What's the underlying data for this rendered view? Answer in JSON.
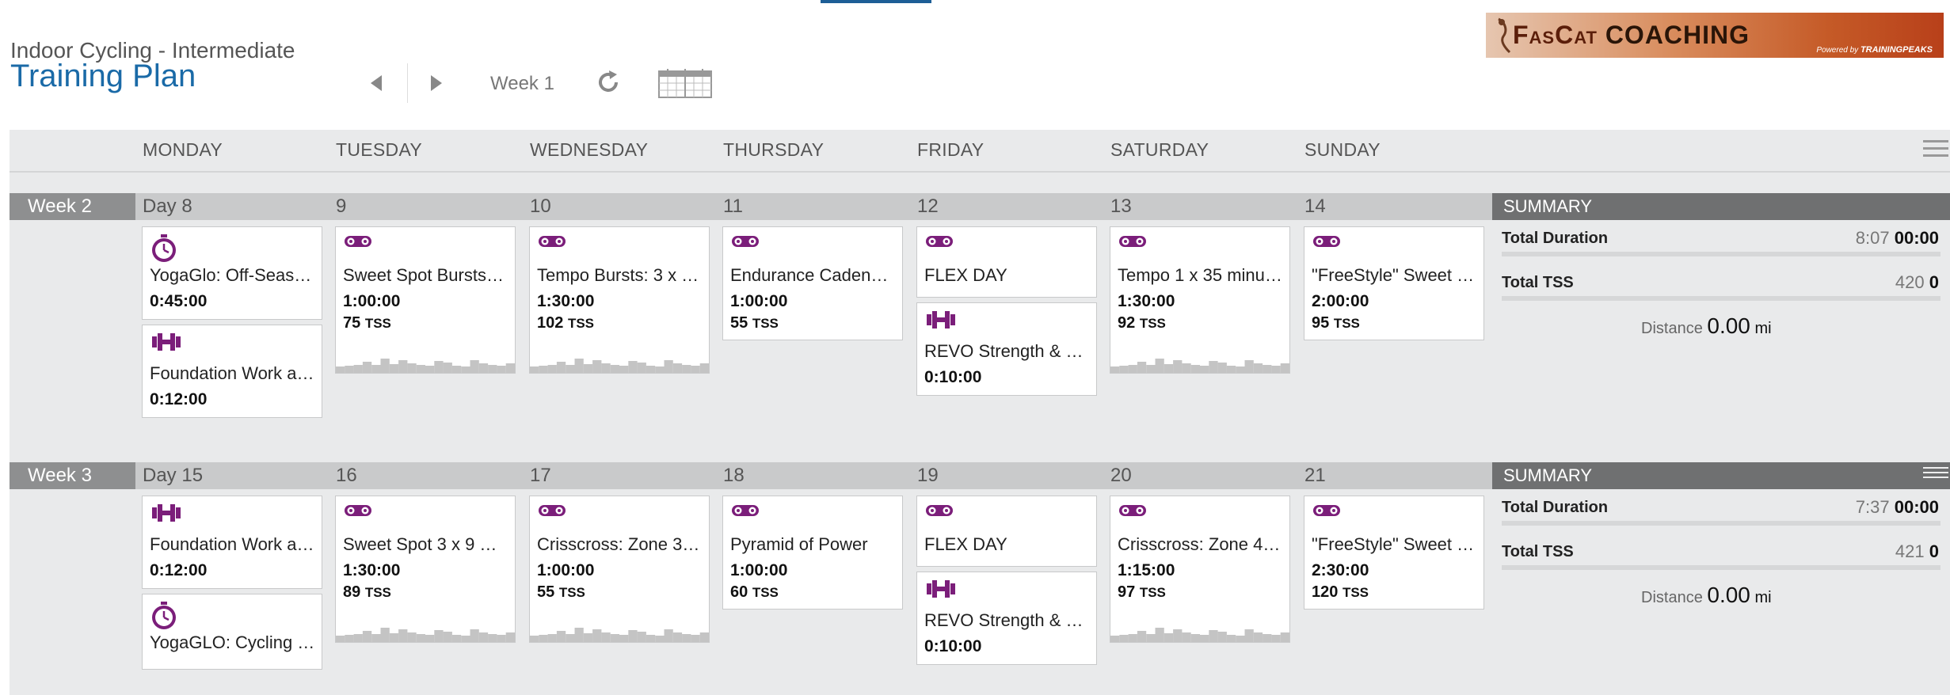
{
  "header": {
    "subtitle": "Indoor Cycling - Intermediate",
    "title": "Training Plan",
    "week_label": "Week 1"
  },
  "logo": {
    "brand_part1": "FasCat",
    "brand_part2": "COACHING",
    "powered_by": "Powered by",
    "powered_brand": "TRAININGPEAKS"
  },
  "days": [
    "MONDAY",
    "TUESDAY",
    "WEDNESDAY",
    "THURSDAY",
    "FRIDAY",
    "SATURDAY",
    "SUNDAY"
  ],
  "weeks": [
    {
      "label": "Week 2",
      "day_numbers": [
        "Day 8",
        "9",
        "10",
        "11",
        "12",
        "13",
        "14"
      ],
      "summary_label": "SUMMARY",
      "summary": {
        "duration_label": "Total Duration",
        "duration_planned": "8:07",
        "duration_done": "00:00",
        "tss_label": "Total TSS",
        "tss_planned": "420",
        "tss_done": "0",
        "distance_label": "Distance",
        "distance_value": "0.00",
        "distance_unit": "mi"
      },
      "workouts": [
        [
          {
            "icon": "stopwatch-icon",
            "title": "YogaGlo: Off-Seas…",
            "duration": "0:45:00"
          },
          {
            "icon": "dumbbell-icon",
            "title": "Foundation Work a…",
            "duration": "0:12:00"
          }
        ],
        [
          {
            "icon": "bike-icon",
            "title": "Sweet Spot Bursts…",
            "duration": "1:00:00",
            "tss": "75",
            "tss_unit": "TSS"
          }
        ],
        [
          {
            "icon": "bike-icon",
            "title": "Tempo Bursts: 3 x …",
            "duration": "1:30:00",
            "tss": "102",
            "tss_unit": "TSS"
          }
        ],
        [
          {
            "icon": "bike-icon",
            "title": "Endurance Caden…",
            "duration": "1:00:00",
            "tss": "55",
            "tss_unit": "TSS"
          }
        ],
        [
          {
            "icon": "bike-icon",
            "title": "FLEX DAY"
          },
          {
            "icon": "dumbbell-icon",
            "title": "REVO Strength & …",
            "duration": "0:10:00"
          }
        ],
        [
          {
            "icon": "bike-icon",
            "title": "Tempo 1 x 35 minu…",
            "duration": "1:30:00",
            "tss": "92",
            "tss_unit": "TSS"
          }
        ],
        [
          {
            "icon": "bike-icon",
            "title": "\"FreeStyle\" Sweet …",
            "duration": "2:00:00",
            "tss": "95",
            "tss_unit": "TSS"
          }
        ]
      ]
    },
    {
      "label": "Week 3",
      "day_numbers": [
        "Day 15",
        "16",
        "17",
        "18",
        "19",
        "20",
        "21"
      ],
      "summary_label": "SUMMARY",
      "summary": {
        "duration_label": "Total Duration",
        "duration_planned": "7:37",
        "duration_done": "00:00",
        "tss_label": "Total TSS",
        "tss_planned": "421",
        "tss_done": "0",
        "distance_label": "Distance",
        "distance_value": "0.00",
        "distance_unit": "mi"
      },
      "workouts": [
        [
          {
            "icon": "dumbbell-icon",
            "title": "Foundation Work a…",
            "duration": "0:12:00"
          },
          {
            "icon": "stopwatch-icon",
            "title": "YogaGLO: Cycling …"
          }
        ],
        [
          {
            "icon": "bike-icon",
            "title": "Sweet Spot 3 x 9 …",
            "duration": "1:30:00",
            "tss": "89",
            "tss_unit": "TSS"
          }
        ],
        [
          {
            "icon": "bike-icon",
            "title": "Crisscross: Zone 3…",
            "duration": "1:00:00",
            "tss": "55",
            "tss_unit": "TSS"
          }
        ],
        [
          {
            "icon": "bike-icon",
            "title": "Pyramid of Power",
            "duration": "1:00:00",
            "tss": "60",
            "tss_unit": "TSS"
          }
        ],
        [
          {
            "icon": "bike-icon",
            "title": "FLEX DAY"
          },
          {
            "icon": "dumbbell-icon",
            "title": "REVO Strength & …",
            "duration": "0:10:00"
          }
        ],
        [
          {
            "icon": "bike-icon",
            "title": "Crisscross: Zone 4…",
            "duration": "1:15:00",
            "tss": "97",
            "tss_unit": "TSS"
          }
        ],
        [
          {
            "icon": "bike-icon",
            "title": "\"FreeStyle\" Sweet …",
            "duration": "2:30:00",
            "tss": "120",
            "tss_unit": "TSS"
          }
        ]
      ]
    }
  ],
  "colors": {
    "accent": "#1a6aa7",
    "workout_icon": "#7b1e7a",
    "summary_bar": "#6f7071",
    "week_tag": "#8e8f90"
  }
}
